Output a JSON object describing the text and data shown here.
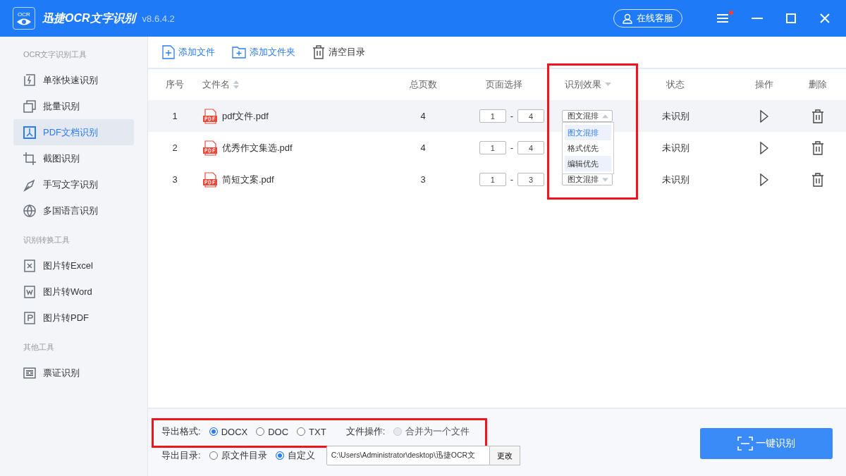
{
  "window": {
    "logo_text": "OCR",
    "title": "迅捷OCR文字识别",
    "version": "v8.6.4.2",
    "support_button": "在线客服",
    "menu_badge": true
  },
  "sidebar": {
    "sections": [
      {
        "title": "OCR文字识别工具",
        "items": [
          {
            "label": "单张快速识别",
            "selected": false
          },
          {
            "label": "批量识别",
            "selected": false
          },
          {
            "label": "PDF文档识别",
            "selected": true
          },
          {
            "label": "截图识别",
            "selected": false
          },
          {
            "label": "手写文字识别",
            "selected": false
          },
          {
            "label": "多国语言识别",
            "selected": false
          }
        ]
      },
      {
        "title": "识别转换工具",
        "items": [
          {
            "label": "图片转Excel",
            "selected": false
          },
          {
            "label": "图片转Word",
            "selected": false
          },
          {
            "label": "图片转PDF",
            "selected": false
          }
        ]
      },
      {
        "title": "其他工具",
        "items": [
          {
            "label": "票证识别",
            "selected": false
          }
        ]
      }
    ]
  },
  "toolbar": [
    {
      "label": "添加文件",
      "kind": "file"
    },
    {
      "label": "添加文件夹",
      "kind": "folder"
    },
    {
      "label": "清空目录",
      "kind": "clear"
    }
  ],
  "table": {
    "columns": [
      "序号",
      "文件名",
      "总页数",
      "页面选择",
      "识别效果",
      "状态",
      "操作",
      "删除"
    ],
    "rows": [
      {
        "index": "1",
        "name": "pdf文件.pdf",
        "pages": "4",
        "from": "1",
        "sep": "-",
        "to": "4",
        "mode": "图文混排",
        "expanded": true,
        "status": "未识别",
        "selected": true
      },
      {
        "index": "2",
        "name": "优秀作文集选.pdf",
        "pages": "4",
        "from": "1",
        "sep": "-",
        "to": "4",
        "status": "未识别",
        "selected": false
      },
      {
        "index": "3",
        "name": "简短文案.pdf",
        "pages": "3",
        "from": "1",
        "sep": "-",
        "to": "3",
        "mode": "图文混排",
        "expanded": false,
        "status": "未识别",
        "selected": false
      }
    ],
    "dropdown_options": [
      {
        "label": "图文混排",
        "selected": true,
        "hovered": false
      },
      {
        "label": "格式优先",
        "selected": false,
        "hovered": false
      },
      {
        "label": "编辑优先",
        "selected": false,
        "hovered": true
      }
    ]
  },
  "footer": {
    "format_label": "导出格式:",
    "formats": [
      {
        "label": "DOCX",
        "selected": true
      },
      {
        "label": "DOC",
        "selected": false
      },
      {
        "label": "TXT",
        "selected": false
      }
    ],
    "file_op_label": "文件操作:",
    "merge": {
      "label": "合并为一个文件",
      "checked": false,
      "disabled": true
    },
    "dir_label": "导出目录:",
    "dirs": [
      {
        "label": "原文件目录",
        "selected": false
      },
      {
        "label": "自定义",
        "selected": true
      }
    ],
    "path": "C:\\Users\\Administrator\\desktop\\迅捷OCR文",
    "change_button": "更改",
    "start_button": "一键识别"
  }
}
